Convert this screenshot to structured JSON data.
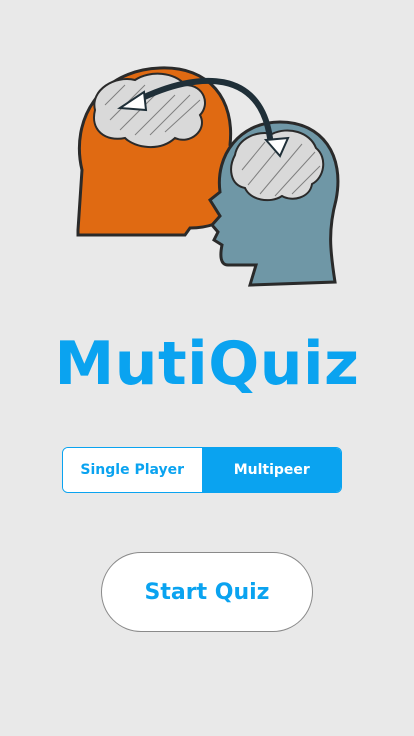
{
  "app": {
    "title": "MutiQuiz",
    "logo_icon": "two-heads-brain-transfer-icon"
  },
  "mode_selector": {
    "options": [
      "Single Player",
      "Multipeer"
    ],
    "selected": "Multipeer"
  },
  "actions": {
    "start_label": "Start Quiz"
  },
  "colors": {
    "accent": "#0aa3f0",
    "background": "#e9e9e9",
    "left_head": "#e06a12",
    "right_head": "#6f97a6"
  }
}
